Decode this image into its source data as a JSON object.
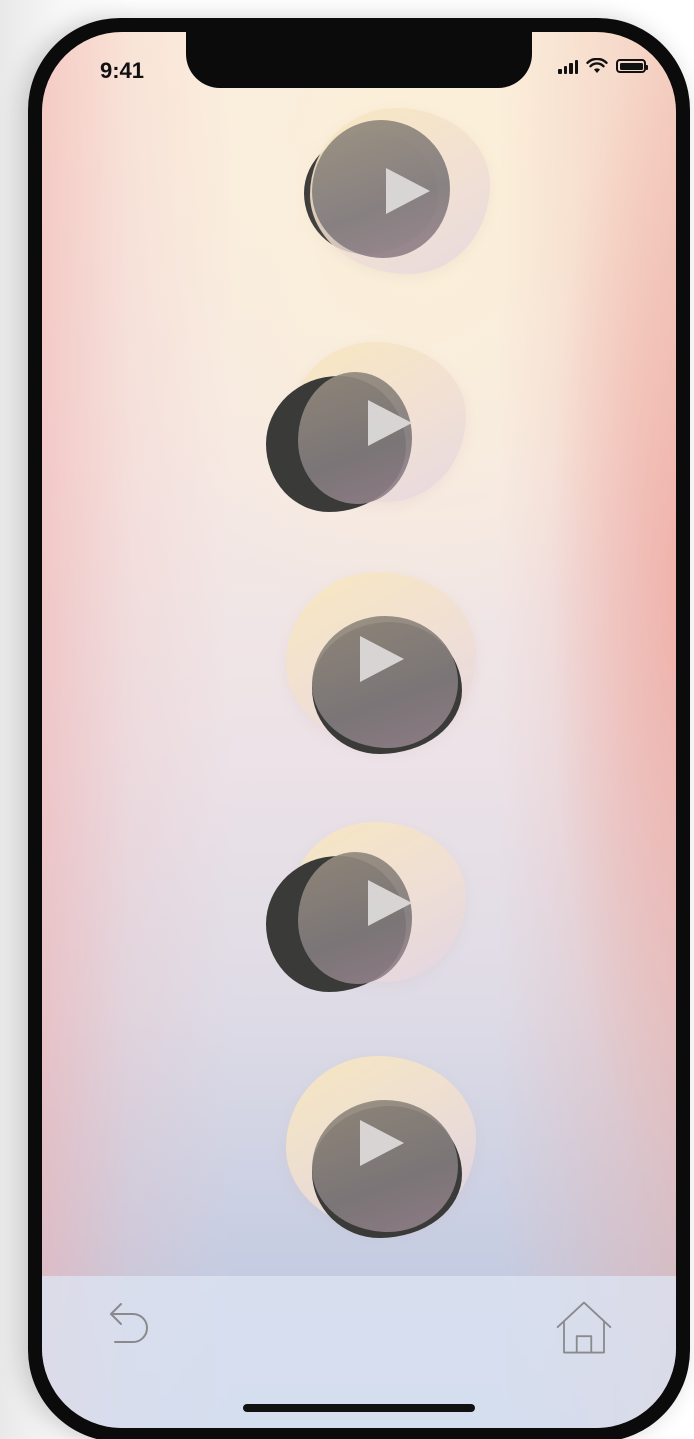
{
  "status_bar": {
    "time": "9:41",
    "signal_icon": "cellular-signal-icon",
    "wifi_icon": "wifi-icon",
    "battery_icon": "battery-icon",
    "battery_level": 1.0
  },
  "main": {
    "play_buttons": [
      {
        "icon": "play-icon",
        "variant": "dark-shadow-right"
      },
      {
        "icon": "play-icon",
        "variant": "dark-shadow-left"
      },
      {
        "icon": "play-icon",
        "variant": "dark-shadow-below"
      },
      {
        "icon": "play-icon",
        "variant": "dark-shadow-left"
      },
      {
        "icon": "play-icon",
        "variant": "dark-shadow-below"
      }
    ]
  },
  "bottom_nav": {
    "back_icon": "back-arrow-icon",
    "home_icon": "home-icon"
  },
  "colors": {
    "frame": "#0b0b0b",
    "background_top": "#fbeedf",
    "background_bottom": "#b9c6e2",
    "nav_bar": "#dce4f2",
    "play_button": "#807a7c"
  }
}
